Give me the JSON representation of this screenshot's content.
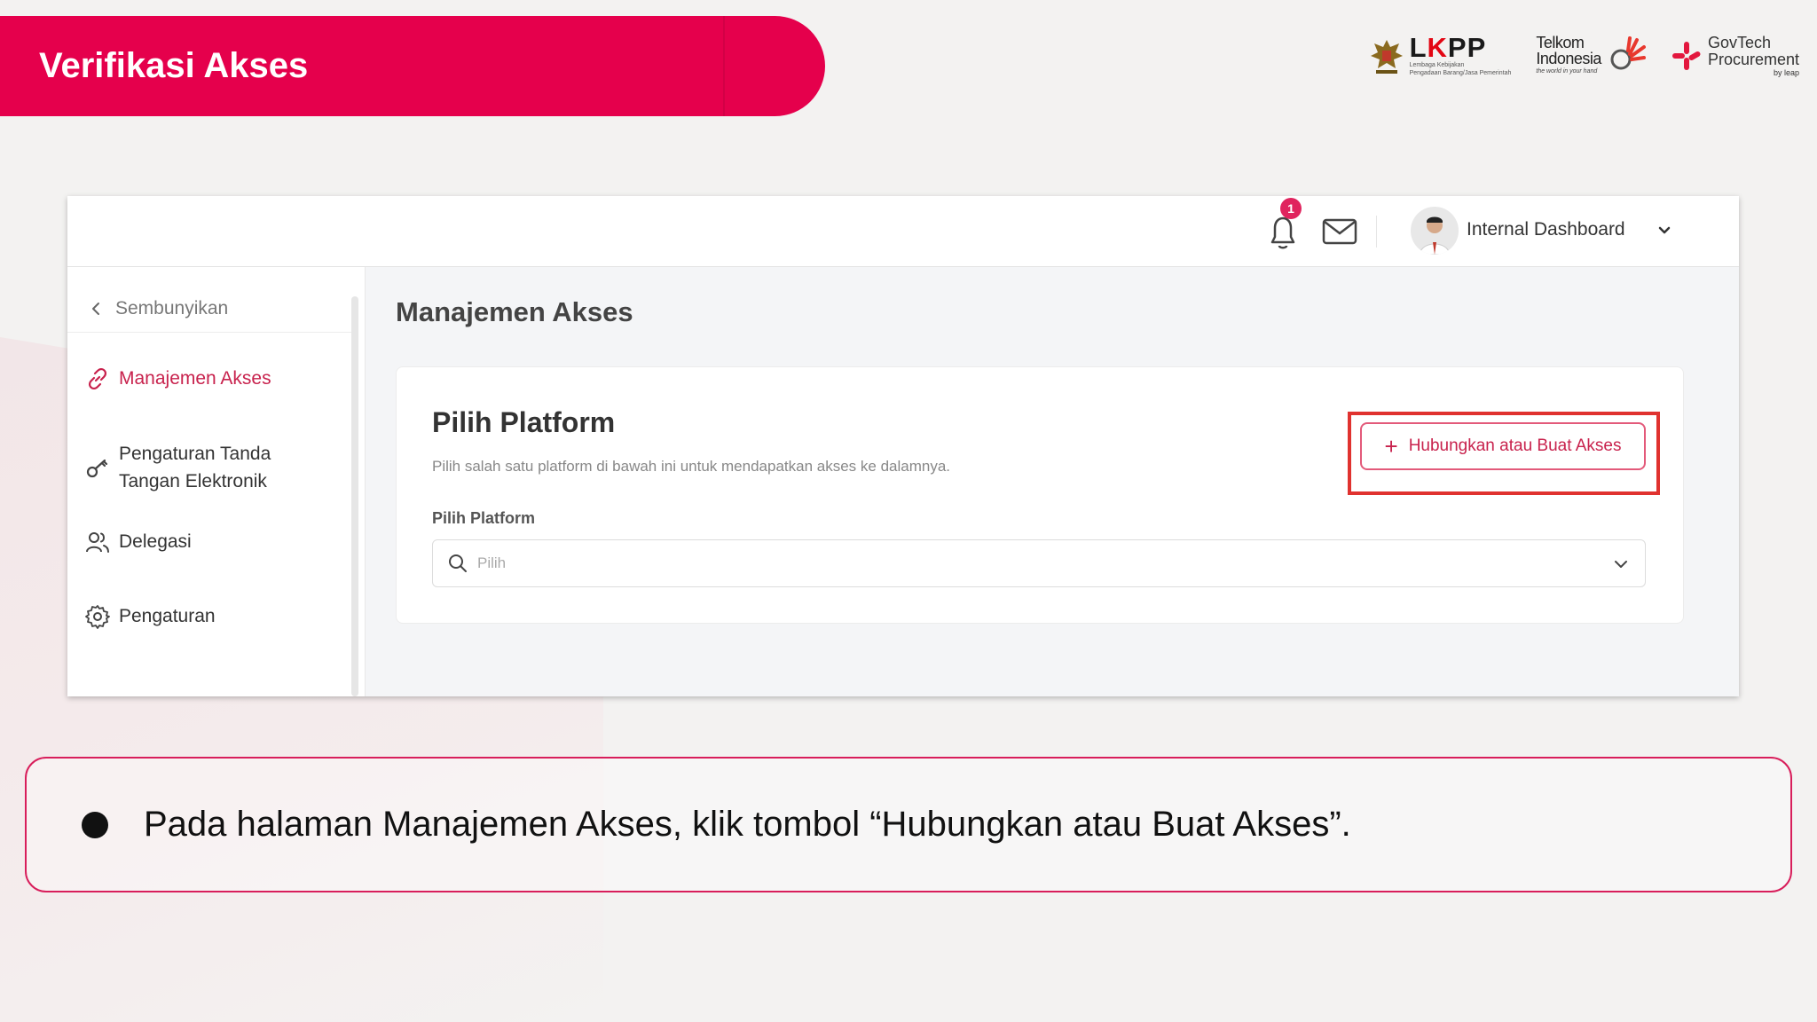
{
  "slide": {
    "title": "Verifikasi Akses"
  },
  "logos": {
    "lkpp": {
      "name_prefix": "L",
      "name_k": "K",
      "name_suffix": "PP",
      "subtitle_1": "Lembaga Kebijakan",
      "subtitle_2": "Pengadaan Barang/Jasa Pemerintah"
    },
    "telkom": {
      "line1": "Telkom",
      "line2": "Indonesia",
      "tagline": "the world in your hand"
    },
    "govtech": {
      "line1": "GovTech",
      "line2": "Procurement",
      "by": "by leap"
    }
  },
  "app": {
    "header": {
      "notification_count": "1",
      "user_label": "Internal Dashboard"
    },
    "sidebar": {
      "hide_label": "Sembunyikan",
      "items": [
        {
          "label": "Manajemen Akses",
          "icon": "link-icon",
          "active": true
        },
        {
          "label": "Pengaturan Tanda Tangan Elektronik",
          "icon": "key-icon",
          "active": false
        },
        {
          "label": "Delegasi",
          "icon": "users-icon",
          "active": false
        },
        {
          "label": "Pengaturan",
          "icon": "gear-icon",
          "active": false
        }
      ]
    },
    "main": {
      "page_title": "Manajemen Akses",
      "card": {
        "title": "Pilih Platform",
        "subtitle": "Pilih salah satu platform di bawah ini untuk mendapatkan akses ke dalamnya.",
        "field_label": "Pilih Platform",
        "select_placeholder": "Pilih",
        "button_label": "Hubungkan atau Buat Akses"
      }
    },
    "colors": {
      "accent": "#c8224d",
      "highlight": "#e0322f"
    }
  },
  "instruction": {
    "text": "Pada halaman Manajemen Akses, klik tombol “Hubungkan atau Buat Akses”."
  },
  "theme": {
    "banner_color": "#e5004c",
    "frame_color": "#d81e5b"
  }
}
